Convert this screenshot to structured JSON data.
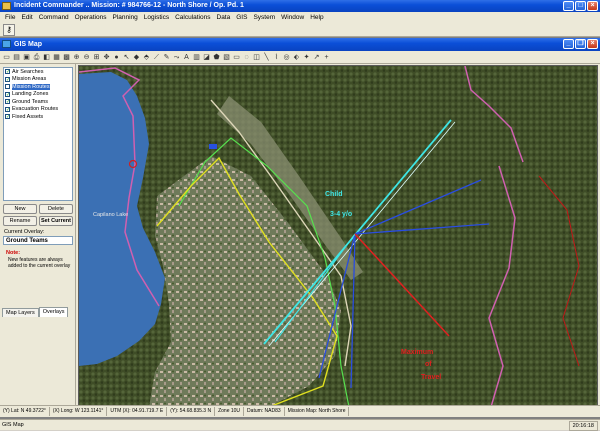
{
  "app": {
    "title": "Incident Commander .. Mission: # 984766-12 - North Shore / Op. Pd. 1",
    "menu": [
      "File",
      "Edit",
      "Command",
      "Operations",
      "Planning",
      "Logistics",
      "Calculations",
      "Data",
      "GIS",
      "System",
      "Window",
      "Help"
    ],
    "status_left": "GIS Map",
    "status_time": "20:16:18"
  },
  "gis_window": {
    "title": "GIS Map",
    "layers": [
      {
        "label": "Air Searches",
        "checked": true
      },
      {
        "label": "Mission Areas",
        "checked": true
      },
      {
        "label": "Mission Routes",
        "checked": false,
        "selected": true
      },
      {
        "label": "Landing Zones",
        "checked": true
      },
      {
        "label": "Ground Teams",
        "checked": true
      },
      {
        "label": "Evacuation Routes",
        "checked": true
      },
      {
        "label": "Fixed Assets",
        "checked": true
      }
    ],
    "buttons": {
      "new": "New",
      "delete": "Delete",
      "rename": "Rename",
      "set_current": "Set Current"
    },
    "current_overlay_label": "Current Overlay:",
    "current_overlay": "Ground Teams",
    "note_title": "Note:",
    "note_text": "New features are always added to the current overlay",
    "tabs": [
      "Map Layers",
      "Overlays"
    ]
  },
  "map": {
    "labels": {
      "lake": "Capilano Lake",
      "child_line1": "Child",
      "child_line2": "3-4 y/o",
      "travel_line1": "Maximum",
      "travel_line2": "of",
      "travel_line3": "Travel"
    },
    "colors": {
      "cyan": "#3ee6e6",
      "blue": "#2a4de0",
      "red": "#e02020",
      "pink": "#d060b0"
    }
  },
  "statusbar": {
    "lat": "(Y) Lat: N 49.3722°",
    "long": "(X) Long: W 123.1141°",
    "utm_e": "UTM (X): 04.91.719.7 E",
    "utm_n": "(Y): 54.68.835.3 N",
    "zone": "Zone 10U",
    "datum": "Datum: NAD83",
    "mission_map": "Mission Map: North Shore"
  }
}
